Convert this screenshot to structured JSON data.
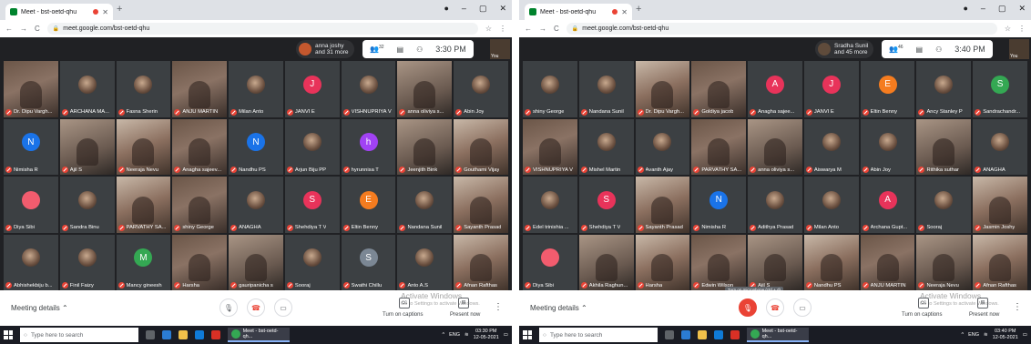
{
  "left": {
    "tab_title": "Meet - bst-oetd-qhu",
    "url": "meet.google.com/bst-oetd-qhu",
    "participants_pill": {
      "line1": "anna joshy",
      "line2": "and 31 more",
      "color": "#c5582e"
    },
    "people_count": "32",
    "time": "3:30 PM",
    "you_label": "You",
    "tiles": [
      {
        "name": "Dr. Dipu Vargh...",
        "kind": "video"
      },
      {
        "name": "ARCHANA MA...",
        "kind": "photo"
      },
      {
        "name": "Fasna Sherin",
        "kind": "photo"
      },
      {
        "name": "ANJU MARTIN",
        "kind": "video"
      },
      {
        "name": "Milan Anto",
        "kind": "photo"
      },
      {
        "name": "JANVI E",
        "kind": "letter",
        "letter": "J",
        "color": "#e8335a"
      },
      {
        "name": "VISHNUPRIYA V",
        "kind": "photo"
      },
      {
        "name": "anna oliviya s...",
        "kind": "video"
      },
      {
        "name": "Abin Joy",
        "kind": "photo"
      },
      {
        "name": "Nimisha R",
        "kind": "letter",
        "letter": "N",
        "color": "#1a73e8"
      },
      {
        "name": "Ajil S",
        "kind": "video"
      },
      {
        "name": "Neeraja Nevu",
        "kind": "video"
      },
      {
        "name": "Anagha sajeev...",
        "kind": "video"
      },
      {
        "name": "Nandhu PS",
        "kind": "letter",
        "letter": "N",
        "color": "#1a73e8"
      },
      {
        "name": "Arjun Biju PP",
        "kind": "photo"
      },
      {
        "name": "hyrunnisa T",
        "kind": "letter",
        "letter": "h",
        "color": "#a142f4"
      },
      {
        "name": "Jeenjith Bink",
        "kind": "video"
      },
      {
        "name": "Gouthami Vijay",
        "kind": "video"
      },
      {
        "name": "Diya Sibi",
        "kind": "letter",
        "letter": "",
        "color": "#f25c6e"
      },
      {
        "name": "Sandra Binu",
        "kind": "photo"
      },
      {
        "name": "PARVATHY SA...",
        "kind": "video"
      },
      {
        "name": "shiny George",
        "kind": "video"
      },
      {
        "name": "ANAGHA",
        "kind": "photo"
      },
      {
        "name": "Shehdiya T V",
        "kind": "letter",
        "letter": "S",
        "color": "#e8335a"
      },
      {
        "name": "Eltin Benny",
        "kind": "letter",
        "letter": "E",
        "color": "#f57c1f"
      },
      {
        "name": "Nandana Sunil",
        "kind": "photo"
      },
      {
        "name": "Sayanth Prasad",
        "kind": "video"
      },
      {
        "name": "Abhishekbiju b...",
        "kind": "photo"
      },
      {
        "name": "Finil Faizy",
        "kind": "photo"
      },
      {
        "name": "Mancy gineesh",
        "kind": "letter",
        "letter": "M",
        "color": "#34a853"
      },
      {
        "name": "Harsha",
        "kind": "video"
      },
      {
        "name": "gauripanicha s",
        "kind": "video"
      },
      {
        "name": "Sooraj",
        "kind": "photo"
      },
      {
        "name": "Swathi Chillu",
        "kind": "letter",
        "letter": "S",
        "color": "#7b8794"
      },
      {
        "name": "Anto A.S",
        "kind": "photo"
      },
      {
        "name": "Afnan Rafthas",
        "kind": "video"
      }
    ],
    "clock_time": "03:30 PM",
    "clock_date": "12-05-2021",
    "mic_tooltip": ""
  },
  "right": {
    "tab_title": "Meet - bst-oetd-qhu",
    "url": "meet.google.com/bst-oetd-qhu",
    "participants_pill": {
      "line1": "Sradha Sunil",
      "line2": "and 45 more",
      "color": "#5f4b3b"
    },
    "people_count": "46",
    "time": "3:40 PM",
    "you_label": "You",
    "tiles": [
      {
        "name": "shiny George",
        "kind": "photo"
      },
      {
        "name": "Nandana Sunil",
        "kind": "photo"
      },
      {
        "name": "Dr. Dipu Vargh...",
        "kind": "video"
      },
      {
        "name": "Goldiya jacob",
        "kind": "video"
      },
      {
        "name": "Anagha sajee...",
        "kind": "letter",
        "letter": "A",
        "color": "#e8335a"
      },
      {
        "name": "JANVI E",
        "kind": "letter",
        "letter": "J",
        "color": "#e8335a"
      },
      {
        "name": "Eltin Benny",
        "kind": "letter",
        "letter": "E",
        "color": "#f57c1f"
      },
      {
        "name": "Ancy Stanley P",
        "kind": "photo"
      },
      {
        "name": "Sandrachandr...",
        "kind": "letter",
        "letter": "S",
        "color": "#34a853"
      },
      {
        "name": "VISHNUPRIYA V",
        "kind": "video"
      },
      {
        "name": "Mishel Martin",
        "kind": "photo"
      },
      {
        "name": "Avanth Ajay",
        "kind": "photo"
      },
      {
        "name": "PARVATHY SA...",
        "kind": "video"
      },
      {
        "name": "anna oliviya s...",
        "kind": "video"
      },
      {
        "name": "Aiswarya M",
        "kind": "photo"
      },
      {
        "name": "Abin Joy",
        "kind": "photo"
      },
      {
        "name": "Rithika suthar",
        "kind": "video"
      },
      {
        "name": "ANAGHA",
        "kind": "photo"
      },
      {
        "name": "Edel trinishia ...",
        "kind": "photo"
      },
      {
        "name": "Shehdiya T V",
        "kind": "letter",
        "letter": "S",
        "color": "#e8335a"
      },
      {
        "name": "Sayanth Prasad",
        "kind": "video"
      },
      {
        "name": "Nimisha R",
        "kind": "letter",
        "letter": "N",
        "color": "#1a73e8"
      },
      {
        "name": "Adithya Prasad",
        "kind": "photo"
      },
      {
        "name": "Milan Anto",
        "kind": "photo"
      },
      {
        "name": "Archana Gupt...",
        "kind": "letter",
        "letter": "A",
        "color": "#e8335a"
      },
      {
        "name": "Sooraj",
        "kind": "photo"
      },
      {
        "name": "Jasmin Joshy",
        "kind": "video"
      },
      {
        "name": "Diya Sibi",
        "kind": "letter",
        "letter": "",
        "color": "#f25c6e"
      },
      {
        "name": "Akhila Raghun...",
        "kind": "video"
      },
      {
        "name": "Harsha",
        "kind": "video"
      },
      {
        "name": "Edwin Wilson",
        "kind": "video"
      },
      {
        "name": "Ajil S",
        "kind": "video"
      },
      {
        "name": "Nandhu PS",
        "kind": "video"
      },
      {
        "name": "ANJU MARTIN",
        "kind": "video"
      },
      {
        "name": "Neeraja Nevu",
        "kind": "video"
      },
      {
        "name": "Afnan Rafthas",
        "kind": "video"
      }
    ],
    "clock_time": "03:40 PM",
    "clock_date": "12-05-2021",
    "mic_tooltip": "Turn on microphone (ctrl + d)"
  },
  "common": {
    "meeting_details": "Meeting details",
    "captions": "Turn on captions",
    "present": "Present now",
    "activate_title": "Activate Windows",
    "activate_sub": "Go to Settings to activate Windows.",
    "search_placeholder": "Type here to search",
    "taskbar_app": "Meet - bst-oetd-qh...",
    "lang": "ENG"
  }
}
